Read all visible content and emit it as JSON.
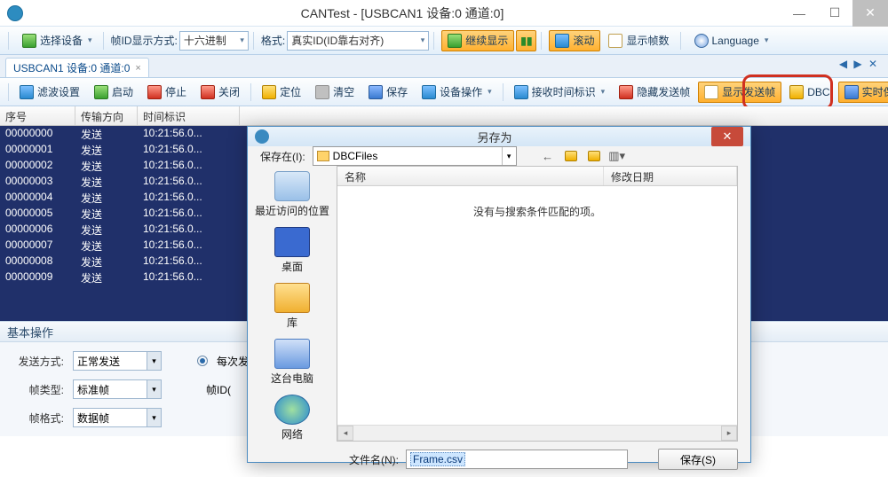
{
  "title": "CANTest  - [USBCAN1 设备:0 通道:0]",
  "winbtns": {
    "min": "—",
    "max": "☐",
    "close": "✕"
  },
  "tb1": {
    "select_device": "选择设备",
    "frame_id_disp_label": "帧ID显示方式:",
    "frame_id_disp_value": "十六进制",
    "format_label": "格式:",
    "format_value": "真实ID(ID靠右对齐)",
    "continue_show": "继续显示",
    "scroll": "滚动",
    "show_count": "显示帧数",
    "language": "Language"
  },
  "tab": {
    "label": "USBCAN1 设备:0 通道:0",
    "close": "×",
    "arrows": "◀ ▶ ✕"
  },
  "tb2": {
    "filter_set": "滤波设置",
    "start": "启动",
    "stop": "停止",
    "close": "关闭",
    "locate": "定位",
    "clear": "清空",
    "save": "保存",
    "dev_ops": "设备操作",
    "recv_time_id": "接收时间标识",
    "hide_send": "隐藏发送帧",
    "show_send": "显示发送帧",
    "dbc": "DBC",
    "realtime_save": "实时保存"
  },
  "grid": {
    "headers": {
      "idx": "序号",
      "dir": "传输方向",
      "time": "时间标识"
    },
    "dir_value": "发送",
    "time_value": "10:21:56.0...",
    "rows": [
      "00000000",
      "00000001",
      "00000002",
      "00000003",
      "00000004",
      "00000005",
      "00000006",
      "00000007",
      "00000008",
      "00000009"
    ]
  },
  "panel": {
    "title": "基本操作",
    "send_mode_label": "发送方式:",
    "send_mode_value": "正常发送",
    "each_send": "每次发送",
    "frame_type_label": "帧类型:",
    "frame_type_value": "标准帧",
    "frame_id_label": "帧ID(",
    "frame_format_label": "帧格式:",
    "frame_format_value": "数据帧"
  },
  "dialog": {
    "title": "另存为",
    "save_in_label": "保存在(I):",
    "folder": "DBCFiles",
    "col_name": "名称",
    "col_date": "修改日期",
    "empty_msg": "没有与搜索条件匹配的项。",
    "places": {
      "recent": "最近访问的位置",
      "desktop": "桌面",
      "libs": "库",
      "thispc": "这台电脑",
      "network": "网络"
    },
    "filename_label": "文件名(N):",
    "filename_value": "Frame.csv",
    "save_btn": "保存(S)"
  }
}
